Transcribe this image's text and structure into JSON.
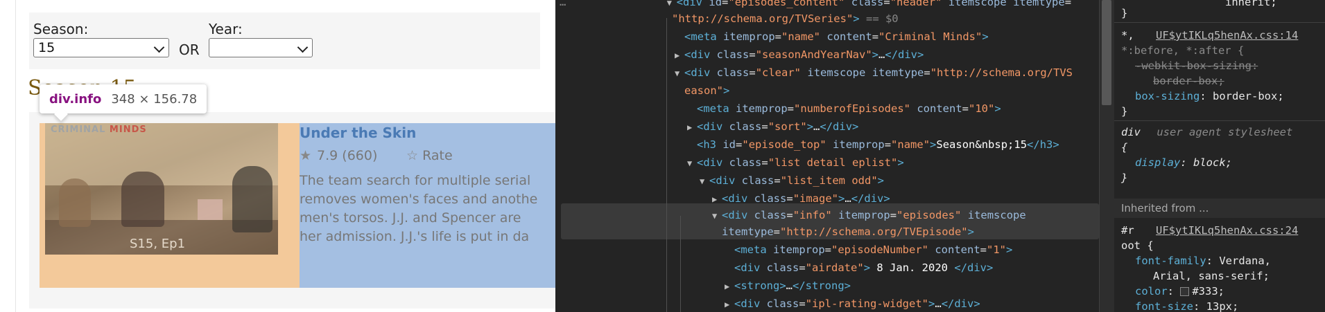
{
  "page": {
    "season_label": "Season:",
    "season_value": "15",
    "or_text": "OR",
    "year_label": "Year:",
    "year_value": "",
    "season_heading": "Season 15",
    "tooltip": {
      "name": "div.info",
      "dims": "348 × 156.78"
    },
    "episode": {
      "thumb_logo_a": "CRIMINAL",
      "thumb_logo_b": "MINDS",
      "thumb_label": "S15, Ep1",
      "title": "Under the Skin",
      "rating": "7.9 (660)",
      "rate_label": "Rate",
      "desc_lines": [
        "The team search for multiple serial",
        "removes women's faces and anothe",
        "men's torsos. J.J. and Spencer are",
        "her admission. J.J.'s life is put in da"
      ]
    }
  },
  "elements_panel": {
    "lines": [
      "<div id=\"episodes_content\" class=\"header\" itemscope itemtype=",
      "\"http://schema.org/TVSeries\" == $0",
      "<meta itemprop=\"name\" content=\"Criminal Minds\">",
      "<div class=\"seasonAndYearNav\">…</div>",
      "<div class=\"clear\" itemscope itemtype=\"http://schema.org/TVS",
      "eason\">",
      "<meta itemprop=\"numberofEpisodes\" content=\"10\">",
      "<div class=\"sort\">…</div>",
      "<h3 id=\"episode_top\" itemprop=\"name\">Season&nbsp;15</h3>",
      "<div class=\"list detail eplist\">",
      "<div class=\"list_item odd\">",
      "<div class=\"image\">…</div>",
      "<div class=\"info\" itemprop=\"episodes\" itemscope",
      "itemtype=\"http://schema.org/TVEpisode\">",
      "<meta itemprop=\"episodeNumber\" content=\"1\">",
      "<div class=\"airdate\"> 8 Jan. 2020 </div>",
      "<strong>…</strong>",
      "<div class=\"ipl-rating-widget\">…</div>"
    ]
  },
  "styles_panel": {
    "top_brace": "}",
    "rule1_selector": "*,",
    "rule1_link": "UF$ytIKLq5henAx.css:14",
    "rule1_selector2": "*:before, *:after {",
    "rule1_prop_struck": "-webkit-box-sizing:",
    "rule1_val_struck": "border-box;",
    "rule1_prop": "box-sizing",
    "rule1_val": "border-box;",
    "rule2_selector": "div",
    "rule2_source": "user agent stylesheet",
    "rule2_open": "{",
    "rule2_prop": "display",
    "rule2_val": "block;",
    "inherited": "Inherited from ...",
    "rule3_selector": "#r",
    "rule3_link": "UF$ytIKLq5henAx.css:24",
    "rule3_selector_cont": "oot {",
    "rule3_prop1": "font-family",
    "rule3_val1a": "Verdana,",
    "rule3_val1b": "Arial, sans-serif;",
    "rule3_prop2": "color",
    "rule3_val2": "#333;",
    "rule3_prop3": "font-size",
    "rule3_val3": "13px;",
    "top_partial": "inherit;"
  },
  "colors": {
    "image_highlight": "#f3c99a",
    "info_highlight": "#a4bfe2",
    "title_blue": "#4a7ab4",
    "devtools_bg": "#242424"
  }
}
